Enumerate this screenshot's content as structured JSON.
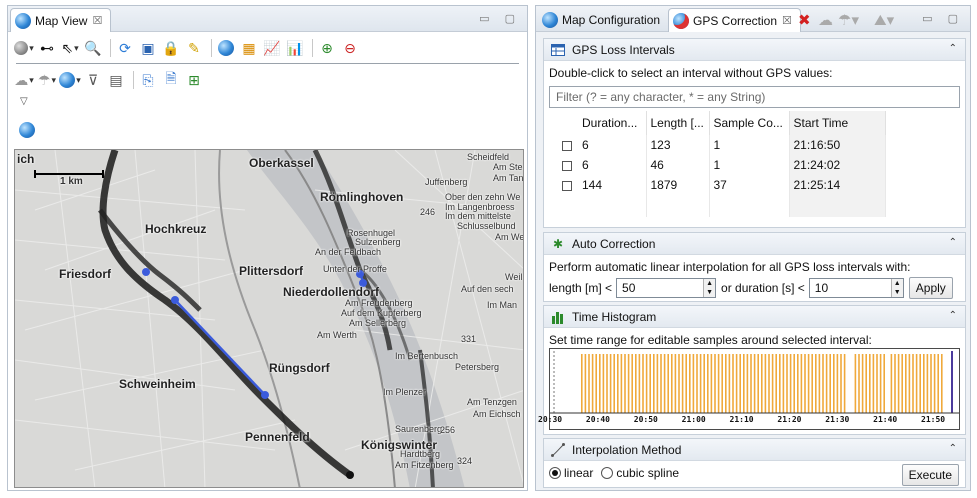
{
  "left": {
    "tab_title": "Map View",
    "tab_close": "☒",
    "window_controls": "▭ ▢",
    "toolbar_overflow": "▽"
  },
  "map": {
    "scale_label": "1 km",
    "labels": {
      "ich": "ich",
      "oberkassel": "Oberkassel",
      "hochkreuz": "Hochkreuz",
      "friesdorf": "Friesdorf",
      "plittersdorf": "Plittersdorf",
      "niederdollendorf": "Niederdollendorf",
      "roemlinghoven": "Römlinghoven",
      "ruengsdorf": "Rüngsdorf",
      "schweinheim": "Schweinheim",
      "pennenfeld": "Pennenfeld",
      "koenigswinter": "Königswinter"
    },
    "small_labels": {
      "scheidfeld": "Scheidfeld",
      "am_ste": "Am Ste",
      "am_tan": "Am Tan",
      "juffenberg": "Juffenberg",
      "ober_den_zehn": "Ober den zehn We",
      "im_langenbroess": "Im Langenbroess",
      "im_mittelste": "Im dem mittelste",
      "schlussel": "Schlusselbund",
      "am_we": "Am We",
      "rosenhugel": "Rosenhugel",
      "sulzenberg": "Sulzenberg",
      "an_der_feldbach": "An der Feldbach",
      "unter_der_proffe": "Unter der Proffe",
      "weil": "Weil",
      "auf_den_sech": "Auf den sech",
      "am_freudenberg": "Am Freudenberg",
      "auf_dem_kupferberg": "Auf dem Kupferberg",
      "am_sellerberg": "Am Sellerberg",
      "im_man": "Im Man",
      "am_werth": "Am Werth",
      "n331": "331",
      "im_bertenbusch": "Im Bertenbusch",
      "petersberg": "Petersberg",
      "im_plenzer": "Im Plenzer",
      "am_tenzgen": "Am Tenzgen",
      "am_eichsch": "Am Eichsch",
      "saurenberg": "Saurenberg",
      "hardtberg": "Hardtberg",
      "am_fitzenberg": "Am Fitzenberg",
      "n246": "246",
      "n256": "256",
      "n324": "324"
    }
  },
  "right": {
    "tabs": [
      {
        "label": "Map Configuration"
      },
      {
        "label": "GPS Correction",
        "close": "☒"
      }
    ],
    "window_controls": "▭ ▢",
    "gps_loss": {
      "title": "GPS Loss Intervals",
      "collapse": "⌃",
      "description": "Double-click to select an interval without GPS values:",
      "filter_placeholder": "Filter (? = any character, * = any String)",
      "columns": [
        "Duration...",
        "Length [...",
        "Sample Co...",
        "Start Time"
      ],
      "rows": [
        {
          "duration": "6",
          "length": "123",
          "samples": "1",
          "start": "21:16:50"
        },
        {
          "duration": "6",
          "length": "46",
          "samples": "1",
          "start": "21:24:02"
        },
        {
          "duration": "144",
          "length": "1879",
          "samples": "37",
          "start": "21:25:14"
        }
      ]
    },
    "auto_correction": {
      "title": "Auto Correction",
      "collapse": "⌃",
      "description": "Perform automatic linear interpolation for all GPS loss intervals with:",
      "length_label": "length [m] <",
      "length_value": "50",
      "duration_label": "or duration [s] <",
      "duration_value": "10",
      "apply_label": "Apply"
    },
    "histogram": {
      "title": "Time Histogram",
      "collapse": "⌃",
      "description": "Set time range for editable samples around selected interval:",
      "ticks": [
        "20:30",
        "20:40",
        "20:50",
        "21:00",
        "21:10",
        "21:20",
        "21:30",
        "21:40",
        "21:50"
      ],
      "bar_color": "#f0a93b"
    },
    "interpolation": {
      "title": "Interpolation Method",
      "collapse": "⌃",
      "options": [
        "linear",
        "cubic spline"
      ],
      "selected": "linear",
      "execute_label": "Execute"
    }
  }
}
